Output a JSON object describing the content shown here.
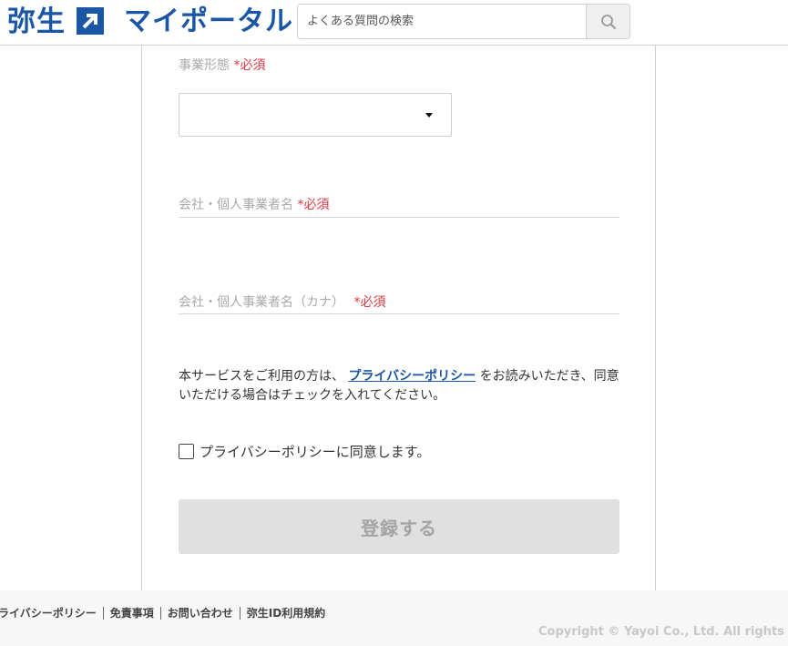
{
  "header": {
    "brand_name": "弥生",
    "portal_name": "マイポータル",
    "search": {
      "placeholder": "よくある質問の検索",
      "value": ""
    },
    "brand_color": "#1a56a6"
  },
  "form": {
    "business_type": {
      "label": "事業形態",
      "required_mark": "*必須",
      "selected_value": ""
    },
    "company_name": {
      "label": "会社・個人事業者名",
      "required_mark": "*必須",
      "value": ""
    },
    "company_name_kana": {
      "label": "会社・個人事業者名（カナ）",
      "required_mark": "*必須",
      "value": ""
    },
    "notice": {
      "before": "本サービスをご利用の方は、",
      "link_text": "プライバシーポリシー",
      "after": "をお読みいただき、同意いただける場合はチェックを入れてください。"
    },
    "agree_label": "プライバシーポリシーに同意します。",
    "submit_label": "登録する"
  },
  "footer": {
    "links": [
      "プライバシーポリシー",
      "免責事項",
      "お問い合わせ",
      "弥生ID利用規約"
    ],
    "copyright": "Copyright © Yayoi Co., Ltd. All rights res"
  }
}
